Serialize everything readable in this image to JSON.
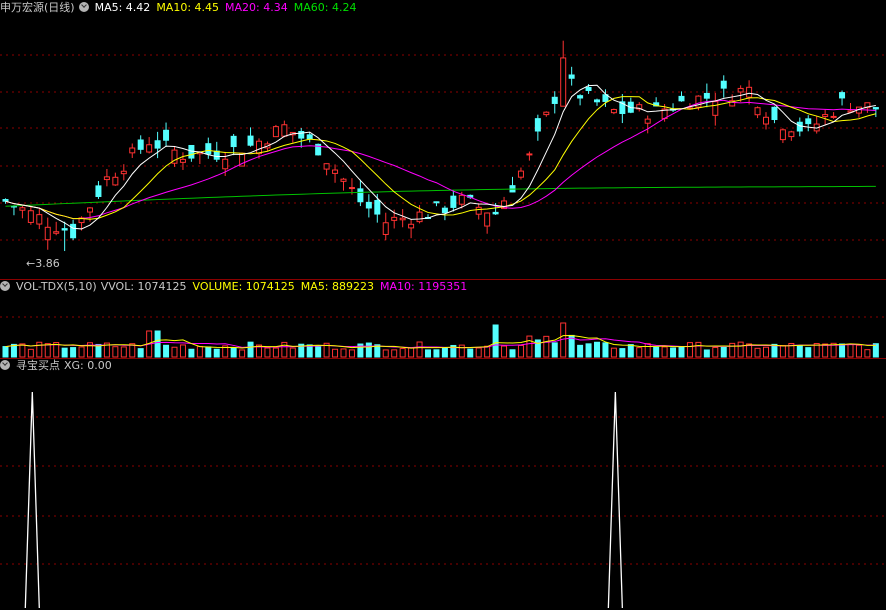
{
  "price_pane": {
    "title": "申万宏源(日线)",
    "indicators": [
      {
        "label": "MA5: 4.42",
        "color": "#ffffff"
      },
      {
        "label": "MA10: 4.45",
        "color": "#ffff00"
      },
      {
        "label": "MA20: 4.34",
        "color": "#ff00ff"
      },
      {
        "label": "MA60: 4.24",
        "color": "#00e000"
      }
    ],
    "low_marker": "3.86"
  },
  "volume_pane": {
    "title": "VOL-TDX(5,10)",
    "indicators": [
      {
        "label": "VVOL: 1074125",
        "color": "#c8c8c8"
      },
      {
        "label": "VOLUME: 1074125",
        "color": "#ffff00"
      },
      {
        "label": "MA5: 889223",
        "color": "#ffff00"
      },
      {
        "label": "MA10: 1195351",
        "color": "#ff00ff"
      }
    ]
  },
  "signal_pane": {
    "title": "寻宝买点",
    "indicators": [
      {
        "label": "XG: 0.00",
        "color": "#c8c8c8"
      }
    ]
  },
  "colors": {
    "up": "#ff3232",
    "down": "#54ffff",
    "grid": "#8b0000",
    "ma5": "#ffffff",
    "ma10": "#ffff00",
    "ma20": "#ff00ff",
    "ma60": "#00c000"
  },
  "chart_data": {
    "type": "candlestick",
    "price_range": [
      3.75,
      5.2
    ],
    "ohlc": [],
    "xg_signal_candles": [
      4,
      73
    ]
  }
}
